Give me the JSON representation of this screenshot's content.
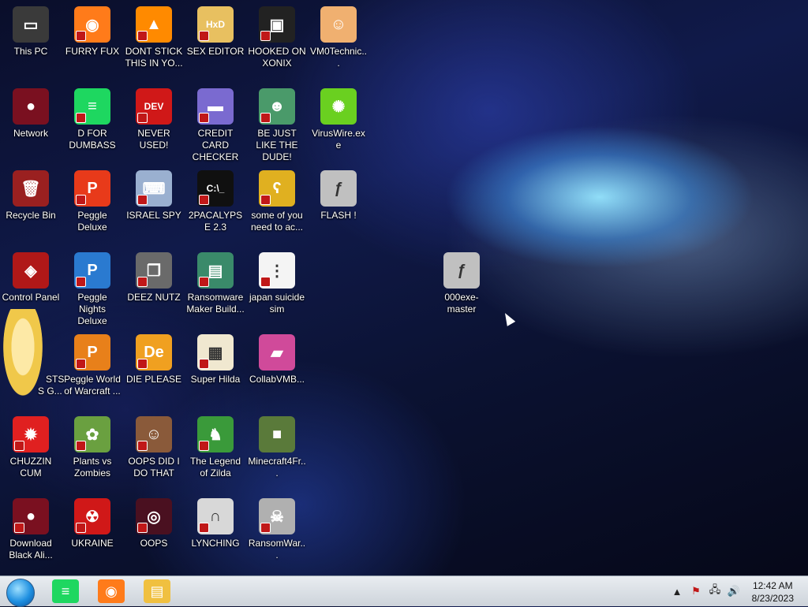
{
  "desktop": {
    "icons": [
      {
        "label": "This PC",
        "glyph": "monitor-icon",
        "color": "#3a3a3a",
        "symbol": "▭",
        "shortcut": false
      },
      {
        "label": "FURRY FUX",
        "glyph": "firefox-icon",
        "color": "#ff7b1a",
        "symbol": "◉",
        "shortcut": true
      },
      {
        "label": "DONT STICK THIS IN YO...",
        "glyph": "vlc-cone-icon",
        "color": "#ff8a00",
        "symbol": "▲",
        "shortcut": true
      },
      {
        "label": "SEX EDITOR",
        "glyph": "hxd-icon",
        "color": "#e8c060",
        "symbol": "HxD",
        "shortcut": true
      },
      {
        "label": "HOOKED ON XONIX",
        "glyph": "xonix-icon",
        "color": "#222222",
        "symbol": "▣",
        "shortcut": true
      },
      {
        "label": "VM0Technic...",
        "glyph": "doctor-icon",
        "color": "#f0b070",
        "symbol": "☺",
        "shortcut": false
      },
      {
        "label": "Network",
        "glyph": "network-globe-icon",
        "color": "#7a1020",
        "symbol": "●",
        "shortcut": false
      },
      {
        "label": "D FOR DUMBASS",
        "glyph": "spotify-icon",
        "color": "#1ed760",
        "symbol": "≡",
        "shortcut": true
      },
      {
        "label": "NEVER USED!",
        "glyph": "devcpp-icon",
        "color": "#d01818",
        "symbol": "DEV",
        "shortcut": true
      },
      {
        "label": "CREDIT CARD CHECKER",
        "glyph": "credit-card-icon",
        "color": "#7a6ad0",
        "symbol": "▬",
        "shortcut": true
      },
      {
        "label": "BE JUST LIKE THE DUDE!",
        "glyph": "gnome-icon",
        "color": "#4a9a6a",
        "symbol": "☻",
        "shortcut": true
      },
      {
        "label": "VirusWire.exe",
        "glyph": "limewire-icon",
        "color": "#6ad020",
        "symbol": "✺",
        "shortcut": false
      },
      {
        "label": "Recycle Bin",
        "glyph": "recycle-bin-icon",
        "color": "#9a2020",
        "symbol": "🗑",
        "shortcut": false
      },
      {
        "label": "Peggle Deluxe",
        "glyph": "peggle-icon",
        "color": "#e83a1a",
        "symbol": "P",
        "shortcut": true
      },
      {
        "label": "ISRAEL SPY",
        "glyph": "network-pc-icon",
        "color": "#9ab0d0",
        "symbol": "⌨",
        "shortcut": true
      },
      {
        "label": "2PACALYPSE 2.3",
        "glyph": "cmd-icon",
        "color": "#101010",
        "symbol": "C:\\_",
        "shortcut": true
      },
      {
        "label": "some of you need to ac...",
        "glyph": "bear-icon",
        "color": "#e0b020",
        "symbol": "ʕ",
        "shortcut": true
      },
      {
        "label": "FLASH !",
        "glyph": "flash-icon",
        "color": "#c0c0c0",
        "symbol": "ƒ",
        "shortcut": false
      },
      {
        "label": "Control Panel",
        "glyph": "control-panel-icon",
        "color": "#b01818",
        "symbol": "◈",
        "shortcut": false
      },
      {
        "label": "Peggle Nights Deluxe",
        "glyph": "peggle-nights-icon",
        "color": "#2a7ad0",
        "symbol": "P",
        "shortcut": true
      },
      {
        "label": "DEEZ NUTZ",
        "glyph": "windows-stack-icon",
        "color": "#6a6a6a",
        "symbol": "❐",
        "shortcut": true
      },
      {
        "label": "Ransomware Maker Build...",
        "glyph": "app-window-icon",
        "color": "#3a8a6a",
        "symbol": "▤",
        "shortcut": true
      },
      {
        "label": "japan suicide sim",
        "glyph": "document-icon",
        "color": "#f4f4f4",
        "symbol": "⋮",
        "shortcut": true
      },
      {
        "label": "Peggle World of Warcraft ...",
        "glyph": "peggle-wow-icon",
        "color": "#e8801a",
        "symbol": "P",
        "shortcut": true
      },
      {
        "label": "DIE PLEASE",
        "glyph": "de-icon",
        "color": "#f0a020",
        "symbol": "De",
        "shortcut": true
      },
      {
        "label": "Super Hilda",
        "glyph": "pixel-cat-icon",
        "color": "#f0e8d0",
        "symbol": "▦",
        "shortcut": true
      },
      {
        "label": "CollabVMB...",
        "glyph": "screen-icon",
        "color": "#d04a9a",
        "symbol": "▰",
        "shortcut": false
      },
      {
        "label": "CHUZZIN CUM",
        "glyph": "chuzzle-icon",
        "color": "#e02020",
        "symbol": "✹",
        "shortcut": true
      },
      {
        "label": "Plants vs Zombies",
        "glyph": "flower-icon",
        "color": "#6aa040",
        "symbol": "✿",
        "shortcut": true
      },
      {
        "label": "OOPS DID I DO THAT",
        "glyph": "portrait-icon",
        "color": "#8a5a3a",
        "symbol": "☺",
        "shortcut": true
      },
      {
        "label": "The Legend of Zilda",
        "glyph": "zelda-icon",
        "color": "#3a9a3a",
        "symbol": "♞",
        "shortcut": true
      },
      {
        "label": "Minecraft4Fr...",
        "glyph": "minecraft-block-icon",
        "color": "#5a7a3a",
        "symbol": "■",
        "shortcut": false
      },
      {
        "label": "Download Black Ali...",
        "glyph": "red-globe-icon",
        "color": "#7a1020",
        "symbol": "●",
        "shortcut": true
      },
      {
        "label": "UKRAINE",
        "glyph": "radiation-icon",
        "color": "#d01818",
        "symbol": "☢",
        "shortcut": true
      },
      {
        "label": "OOPS",
        "glyph": "dark-card-icon",
        "color": "#4a1020",
        "symbol": "◎",
        "shortcut": true
      },
      {
        "label": "LYNCHING",
        "glyph": "noose-icon",
        "color": "#d8d8d8",
        "symbol": "∩",
        "shortcut": true
      },
      {
        "label": "RansomWar...",
        "glyph": "skull-icon",
        "color": "#b0b0b0",
        "symbol": "☠",
        "shortcut": true
      },
      {
        "label": "000exe-master",
        "glyph": "flash-icon",
        "color": "#c0c0c0",
        "symbol": "ƒ",
        "shortcut": false
      }
    ],
    "partial_labels": [
      "STS",
      "S G..."
    ]
  },
  "taskbar": {
    "pinned": [
      {
        "name": "spotify-taskbar-icon",
        "color": "#1ed760",
        "symbol": "≡"
      },
      {
        "name": "firefox-taskbar-icon",
        "color": "#ff7b1a",
        "symbol": "◉"
      },
      {
        "name": "file-explorer-taskbar-icon",
        "color": "#f0c040",
        "symbol": "▤"
      }
    ],
    "clock": {
      "time": "12:42 AM",
      "date": "8/23/2023"
    }
  }
}
